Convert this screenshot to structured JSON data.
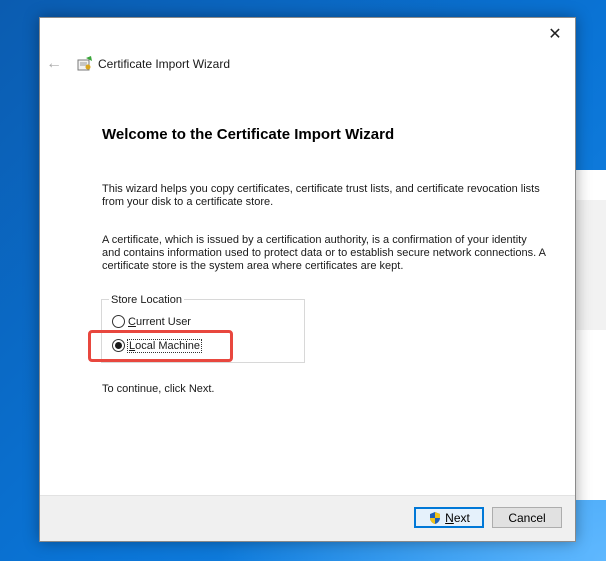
{
  "window": {
    "title": "Certificate Import Wizard",
    "close_glyph": "✕",
    "back_glyph": "←"
  },
  "content": {
    "heading": "Welcome to the Certificate Import Wizard",
    "paragraph1": "This wizard helps you copy certificates, certificate trust lists, and certificate revocation lists from your disk to a certificate store.",
    "paragraph2": "A certificate, which is issued by a certification authority, is a confirmation of your identity and contains information used to protect data or to establish secure network connections. A certificate store is the system area where certificates are kept.",
    "store_location": {
      "legend": "Store Location",
      "options": [
        {
          "label_accel": "C",
          "label_rest": "urrent User",
          "selected": false
        },
        {
          "label_accel": "L",
          "label_rest": "ocal Machine",
          "selected": true
        }
      ]
    },
    "continue_text": "To continue, click Next."
  },
  "footer": {
    "next_accel": "N",
    "next_rest": "ext",
    "cancel_label": "Cancel"
  },
  "icons": {
    "title": "certificate-wizard-icon",
    "next": "uac-shield-icon"
  },
  "colors": {
    "highlight": "#e8473e",
    "default_button_border": "#0078d7",
    "desktop": "#0a6fc9"
  }
}
